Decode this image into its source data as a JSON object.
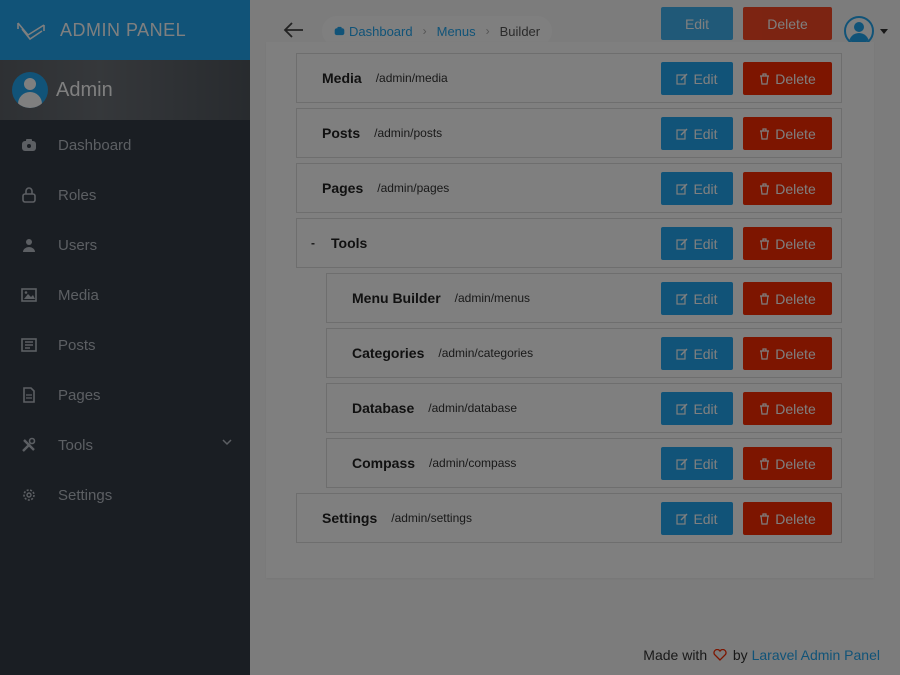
{
  "brand": {
    "title": "ADMIN PANEL"
  },
  "profile": {
    "name": "Admin"
  },
  "sidebar": {
    "items": [
      {
        "label": "Dashboard",
        "icon": "dashboard-icon"
      },
      {
        "label": "Roles",
        "icon": "lock-icon"
      },
      {
        "label": "Users",
        "icon": "user-icon"
      },
      {
        "label": "Media",
        "icon": "image-icon"
      },
      {
        "label": "Posts",
        "icon": "news-icon"
      },
      {
        "label": "Pages",
        "icon": "file-icon"
      },
      {
        "label": "Tools",
        "icon": "tools-icon",
        "has_submenu": true
      },
      {
        "label": "Settings",
        "icon": "gear-icon"
      }
    ]
  },
  "breadcrumb": {
    "items": [
      {
        "label": "Dashboard"
      },
      {
        "label": "Menus"
      },
      {
        "label": "Builder"
      }
    ]
  },
  "header": {
    "edit_label": "Edit",
    "delete_label": "Delete"
  },
  "menu_items": [
    {
      "title": "Media",
      "url": "/admin/media",
      "level": 0
    },
    {
      "title": "Posts",
      "url": "/admin/posts",
      "level": 0
    },
    {
      "title": "Pages",
      "url": "/admin/pages",
      "level": 0
    },
    {
      "title": "Tools",
      "url": "",
      "level": 0,
      "toggle": "-"
    },
    {
      "title": "Menu Builder",
      "url": "/admin/menus",
      "level": 1
    },
    {
      "title": "Categories",
      "url": "/admin/categories",
      "level": 1
    },
    {
      "title": "Database",
      "url": "/admin/database",
      "level": 1
    },
    {
      "title": "Compass",
      "url": "/admin/compass",
      "level": 1
    },
    {
      "title": "Settings",
      "url": "/admin/settings",
      "level": 0
    }
  ],
  "buttons": {
    "edit": "Edit",
    "delete": "Delete"
  },
  "footer": {
    "made_with": "Made with",
    "by": "by",
    "link": "Laravel Admin Panel"
  },
  "colors": {
    "accent": "#22a7f0",
    "danger": "#fa2a00",
    "sidebar": "#353d47"
  }
}
